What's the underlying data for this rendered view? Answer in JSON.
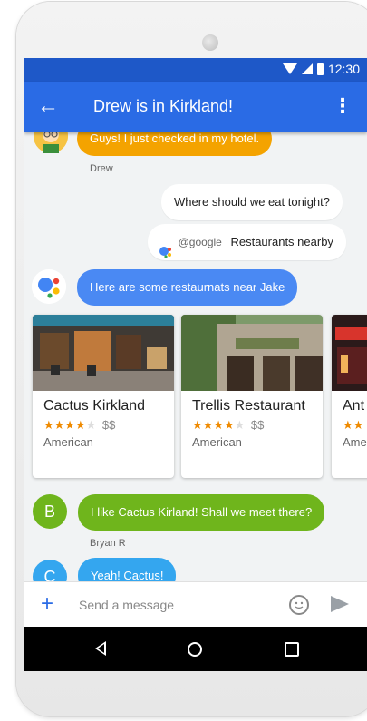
{
  "status": {
    "time": "12:30"
  },
  "appbar": {
    "title": "Drew is in Kirkland!"
  },
  "messages": {
    "drew_text": "Guys! I just checked in my hotel.",
    "drew_name": "Drew",
    "user_question": "Where should we eat tonight?",
    "google_handle": "@google",
    "google_query": "Restaurants nearby",
    "assistant_reply": "Here are some restaurnats near Jake",
    "bryan_initial": "B",
    "bryan_text": "I like Cactus Kirland! Shall we meet there?",
    "bryan_name": "Bryan R",
    "c_initial": "C",
    "c_text": "Yeah! Cactus!"
  },
  "cards": [
    {
      "name": "Cactus Kirkland",
      "rating": 4,
      "price": "$$",
      "cuisine": "American",
      "stars_on": "★★★★",
      "stars_off": "★"
    },
    {
      "name": "Trellis Restaurant",
      "rating": 4,
      "price": "$$",
      "cuisine": "American",
      "stars_on": "★★★★",
      "stars_off": "★"
    },
    {
      "name": "Ant",
      "rating": 2,
      "price": "",
      "cuisine": "Ame",
      "stars_on": "★★",
      "stars_off": ""
    }
  ],
  "composer": {
    "placeholder": "Send a message"
  },
  "colors": {
    "appbar": "#2a6be5",
    "statusbar": "#1e58c8",
    "drew_bubble": "#f4a300",
    "assistant_bubble": "#4a89f3",
    "bryan_bubble": "#6fb51c",
    "c_bubble": "#34a6ef"
  },
  "icons": [
    "back-arrow-icon",
    "overflow-menu-icon",
    "wifi-icon",
    "signal-icon",
    "battery-icon",
    "google-assistant-icon",
    "add-icon",
    "emoji-icon",
    "send-icon",
    "nav-back-icon",
    "nav-home-icon",
    "nav-recents-icon"
  ]
}
